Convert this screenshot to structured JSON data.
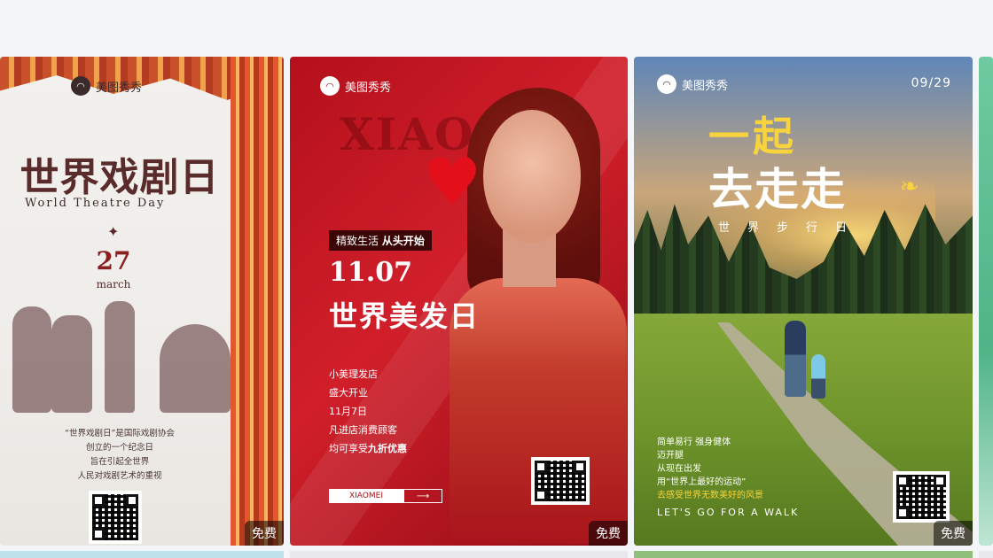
{
  "cards": [
    {
      "brand": "美图秀秀",
      "title": "世界戏剧日",
      "subtitle": "World Theatre Day",
      "date": "27",
      "month": "march",
      "lines": [
        "“世界戏剧日”是国际戏剧协会",
        "创立的一个纪念日",
        "旨在引起全世界",
        "人民对戏剧艺术的重视"
      ],
      "badge": "免费"
    },
    {
      "brand": "美图秀秀",
      "watermark": "XIAO",
      "tag_prefix": "精致生活",
      "tag_bold": "从头开始",
      "date": "11.07",
      "title": "世界美发日",
      "info": [
        "小美理发店",
        "盛大开业",
        "11月7日",
        "凡进店消费顾客",
        "均可享受"
      ],
      "info_highlight": "九折优惠",
      "button_label": "XIAOMEI",
      "button_arrow": "⟶",
      "badge": "免费"
    },
    {
      "brand": "美图秀秀",
      "date": "09/29",
      "title_line1": "一起",
      "title_line2": "去走走",
      "subtitle": "世界步行日",
      "info": [
        "简单易行 强身健体",
        "迈开腿",
        "从现在出发",
        "用“世界上最好的运动”"
      ],
      "info_highlight": "去感受世界无数美好的风景",
      "walk_text": "LET'S GO FOR  A WALK",
      "badge": "免费"
    }
  ],
  "icons": {
    "brand_logo": "meitu-logo-icon",
    "diamond": "diamond-icon",
    "qr": "qr-code-icon",
    "footprint": "footprint-icon"
  }
}
